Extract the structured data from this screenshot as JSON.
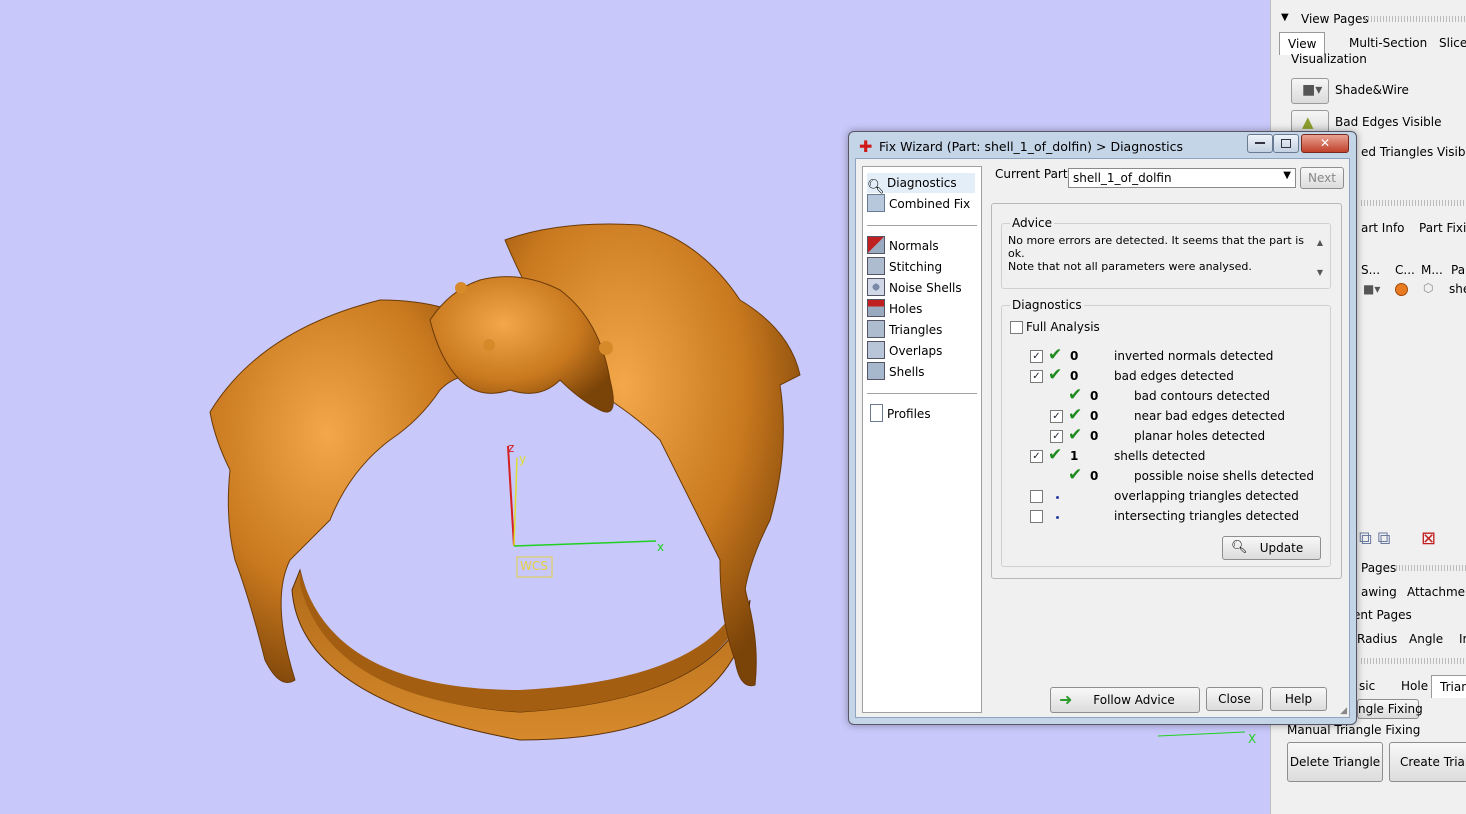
{
  "colors": {
    "viewport_bg": "#c8c8fa",
    "model": "#c8781e",
    "check": "#1f8a1f",
    "dialog_frame": "#c5d5e8"
  },
  "viewport": {
    "wcs_label": "WCS",
    "axis_x": "x",
    "axis_y": "y",
    "axis_z": "z",
    "axis2_x": "X"
  },
  "side_panel": {
    "view_pages_title": "View Pages",
    "tabs": [
      "View",
      "Multi-Section",
      "Slices"
    ],
    "visualization_label": "Visualization",
    "vis_items": [
      {
        "label": "Shade&Wire",
        "icon": "shade-wire-icon"
      },
      {
        "label": "Bad Edges Visible",
        "icon": "bad-edges-icon"
      },
      {
        "label": "ed Triangles Visible",
        "icon": "triangles-visible-icon"
      }
    ],
    "tabs2": [
      "art Info",
      "Part Fixing"
    ],
    "columns": [
      "S...",
      "C...",
      "M...",
      "Par"
    ],
    "row_name": "shel",
    "pages_label": "Pages",
    "tabs3": [
      "awing",
      "Attachments"
    ],
    "ent_pages_label": "ent Pages",
    "tabs4": [
      "Radius",
      "Angle",
      "Ir"
    ],
    "tabs5": [
      "sic",
      "Hole",
      "Trian"
    ],
    "triangle_fixing_btn": "ngle Fixing",
    "manual_label": "Manual Triangle Fixing",
    "delete_triangle": "Delete Triangle",
    "create_triangle": "Create Triangl"
  },
  "dialog": {
    "title": "Fix Wizard (Part: shell_1_of_dolfin) > Diagnostics",
    "nav": [
      {
        "label": "Diagnostics",
        "icon": "magnifier-icon",
        "selected": true
      },
      {
        "label": "Combined Fix",
        "icon": "combined-fix-icon"
      },
      {
        "label": "Normals",
        "icon": "normals-icon"
      },
      {
        "label": "Stitching",
        "icon": "stitching-icon"
      },
      {
        "label": "Noise Shells",
        "icon": "noise-shells-icon"
      },
      {
        "label": "Holes",
        "icon": "holes-icon"
      },
      {
        "label": "Triangles",
        "icon": "triangles-icon"
      },
      {
        "label": "Overlaps",
        "icon": "overlaps-icon"
      },
      {
        "label": "Shells",
        "icon": "shells-icon"
      },
      {
        "label": "Profiles",
        "icon": "profiles-icon"
      }
    ],
    "current_part_label": "Current Part:",
    "current_part_value": "shell_1_of_dolfin",
    "next_label": "Next",
    "advice_title": "Advice",
    "advice_text_1": "No more errors are detected. It seems that the part is ok.",
    "advice_text_2": "Note that not all parameters were analysed.",
    "diagnostics_title": "Diagnostics",
    "full_analysis_label": "Full Analysis",
    "rows": [
      {
        "checkbox": true,
        "status": "ok",
        "value": "0",
        "label": "inverted normals detected",
        "indent": 0
      },
      {
        "checkbox": true,
        "status": "ok",
        "value": "0",
        "label": "bad edges detected",
        "indent": 0
      },
      {
        "checkbox": null,
        "status": "ok",
        "value": "0",
        "label": "bad contours detected",
        "indent": 1
      },
      {
        "checkbox": true,
        "status": "ok",
        "value": "0",
        "label": "near bad edges detected",
        "indent": 1
      },
      {
        "checkbox": true,
        "status": "ok",
        "value": "0",
        "label": "planar holes detected",
        "indent": 1
      },
      {
        "checkbox": true,
        "status": "ok",
        "value": "1",
        "label": "shells detected",
        "indent": 0
      },
      {
        "checkbox": null,
        "status": "ok",
        "value": "0",
        "label": "possible noise shells detected",
        "indent": 1
      },
      {
        "checkbox": false,
        "status": "none",
        "value": "",
        "label": "overlapping triangles detected",
        "indent": 0
      },
      {
        "checkbox": false,
        "status": "none",
        "value": "",
        "label": "intersecting triangles detected",
        "indent": 0
      }
    ],
    "update_label": "Update",
    "follow_advice_label": "Follow Advice",
    "close_label": "Close",
    "help_label": "Help"
  }
}
